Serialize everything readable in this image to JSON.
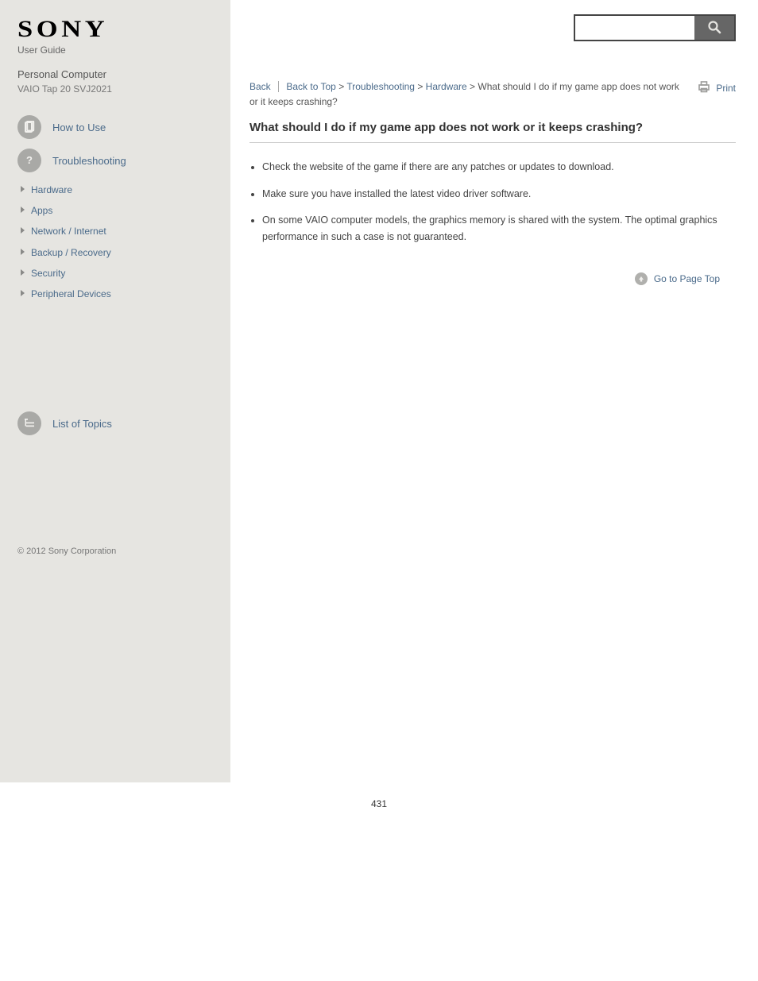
{
  "header": {
    "logo_text": "SONY",
    "subtitle": "User Guide",
    "product_title": "Personal Computer",
    "product_model": "VAIO Tap 20 SVJ2021"
  },
  "search": {
    "placeholder": "",
    "button_label": "Search"
  },
  "sidebar": {
    "nav": [
      {
        "label": "How to Use",
        "icon": "doc"
      },
      {
        "label": "Troubleshooting",
        "icon": "question"
      }
    ],
    "sub_items": [
      "Hardware",
      "Apps",
      "Network / Internet",
      "Backup / Recovery",
      "Security",
      "Peripheral Devices"
    ],
    "contents_label": "List of Topics",
    "copyright": "© 2012 Sony Corporation"
  },
  "breadcrumb": {
    "back_label": "Back",
    "sep_back": "|",
    "link1": "Back to Top",
    "sep": ">",
    "link2": "Troubleshooting",
    "link3": "Hardware",
    "current": "What should I do if my game app does not work or it keeps crashing?"
  },
  "print_label": "Print",
  "article": {
    "title": "What should I do if my game app does not work or it keeps crashing?",
    "bullets": [
      "Check the website of the game if there are any patches or updates to download.",
      "Make sure you have installed the latest video driver software.",
      "On some VAIO computer models, the graphics memory is shared with the system. The optimal graphics performance in such a case is not guaranteed."
    ]
  },
  "gototop_label": "Go to Page Top",
  "page_number": "431"
}
